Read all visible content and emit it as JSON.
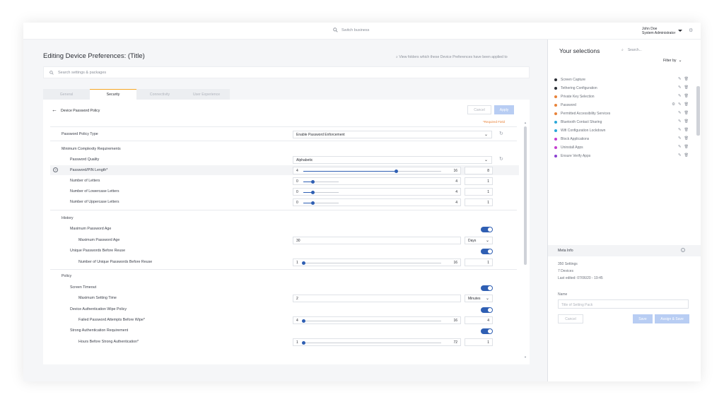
{
  "topbar": {
    "search_placeholder": "Switch business",
    "user_name": "John Doe",
    "user_role": "System Administrator"
  },
  "page": {
    "title": "Editing Device Preferences: (Title)",
    "applied_link": "View folders which these Device Preferences have been applied to",
    "search_placeholder": "Search settings & packages"
  },
  "tabs": [
    {
      "label": "General"
    },
    {
      "label": "Security"
    },
    {
      "label": "Connectivity"
    },
    {
      "label": "User Experience"
    }
  ],
  "panel": {
    "title": "Device Password Policy",
    "cancel_label": "Cancel",
    "apply_label": "Apply",
    "required_note": "*Required Field",
    "password_policy_type": {
      "label": "Password Policy Type",
      "value": "Enable Password Enforcement"
    },
    "min_complexity": {
      "label": "Minimum Complexity Requirements"
    },
    "password_quality": {
      "label": "Password Quality",
      "value": "Alphabetic"
    },
    "pin_length": {
      "label": "Password/PIN Length*",
      "min": "4",
      "max": "16",
      "value": "8",
      "level": 0.67
    },
    "num_letters": {
      "label": "Number of Letters",
      "min": "0",
      "max": "4",
      "value": "1",
      "level": 0.25
    },
    "num_lower": {
      "label": "Number of Lowercase Letters",
      "min": "0",
      "max": "4",
      "value": "1",
      "level": 0.25
    },
    "num_upper": {
      "label": "Number of Uppercase Letters",
      "min": "0",
      "max": "4",
      "value": "1",
      "level": 0.25
    },
    "history": {
      "label": "History"
    },
    "max_age_toggle": {
      "label": "Maximum Password Age"
    },
    "max_age": {
      "label": "Maximum Password Age",
      "value": "30",
      "unit": "Days"
    },
    "unique_toggle": {
      "label": "Unique Passwords Before Reuse"
    },
    "unique_count": {
      "label": "Number of Unique Passwords Before Reuse",
      "min": "1",
      "max": "16",
      "value": "1",
      "level": 0.0
    },
    "policy": {
      "label": "Policy"
    },
    "screen_timeout": {
      "label": "Screen Timeout"
    },
    "max_setting_time": {
      "label": "Maximum Setting Time",
      "value": "2",
      "unit": "Minutes"
    },
    "wipe_policy": {
      "label": "Device Authentication Wipe Policy"
    },
    "failed_attempts": {
      "label": "Failed Password Attempts Before Wipe*",
      "min": "4",
      "max": "16",
      "value": "4",
      "level": 0.0
    },
    "strong_auth": {
      "label": "Strong Authentication Requirement"
    },
    "hours_strong": {
      "label": "Hours Before Strong Authentication*",
      "min": "1",
      "max": "72",
      "value": "1",
      "level": 0.0
    }
  },
  "right": {
    "title": "Your selections",
    "search_placeholder": "Search...",
    "filter_label": "Filter by",
    "selections": [
      {
        "label": "Screen Capture",
        "color": "#2c2f36"
      },
      {
        "label": "Tethering Configuration",
        "color": "#2c2f36"
      },
      {
        "label": "Private Key Selection",
        "color": "#e8833a"
      },
      {
        "label": "Password",
        "color": "#e8833a"
      },
      {
        "label": "Permitted Accessibility Services",
        "color": "#e8833a"
      },
      {
        "label": "Bluetooth Contact Sharing",
        "color": "#2aa7d8"
      },
      {
        "label": "Wifi Configuration Lockdown",
        "color": "#2aa7d8"
      },
      {
        "label": "Block Applications",
        "color": "#c53fd1"
      },
      {
        "label": "Uninstall Apps",
        "color": "#c53fd1"
      },
      {
        "label": "Ensure Verify Apps",
        "color": "#8b3fd1"
      }
    ],
    "meta_title": "Meta Info",
    "meta_settings": "350 Settings",
    "meta_devices": "7 Devices",
    "meta_edited": "Last edited: 07/06/20 - 19:45",
    "name_label": "Name",
    "name_placeholder": "Title of Setting Pack",
    "cancel_label": "Cancel",
    "save_label": "Save",
    "assign_label": "Assign & Save"
  }
}
